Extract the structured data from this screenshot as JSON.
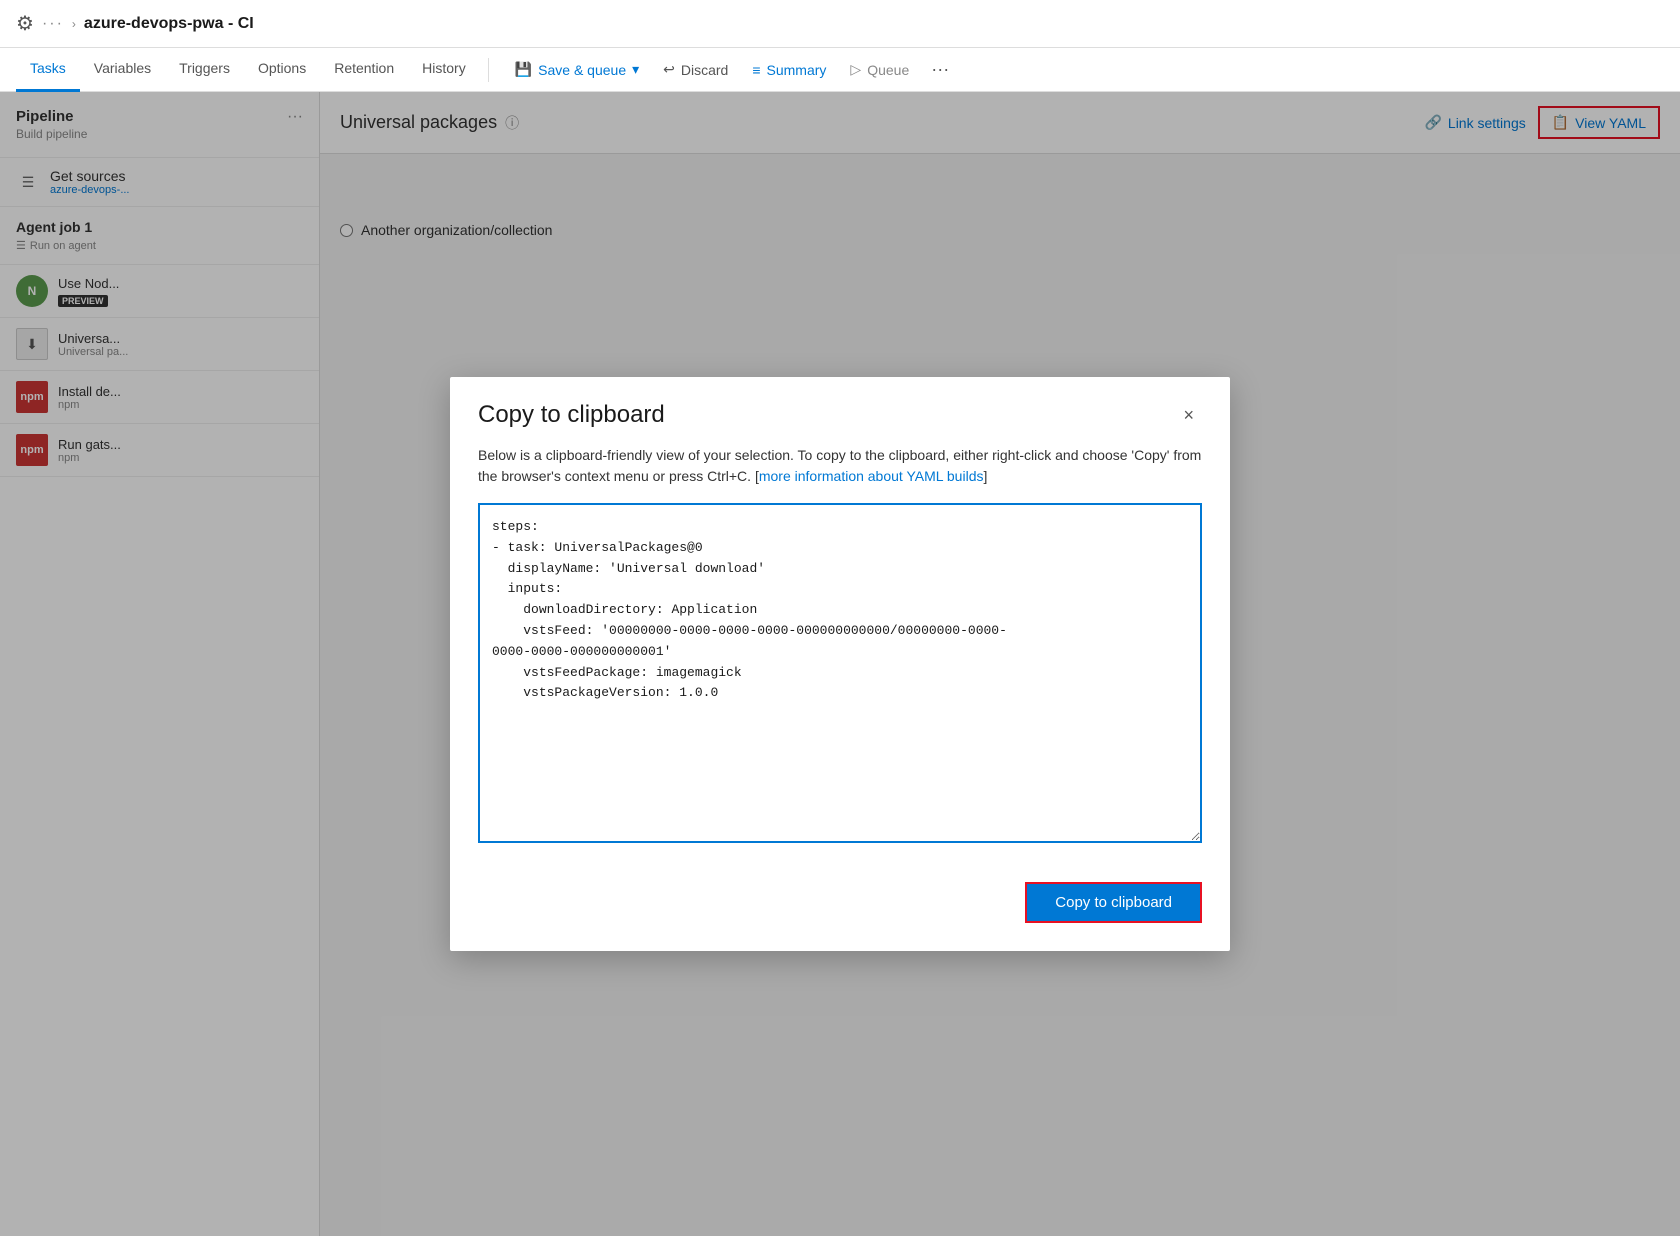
{
  "topbar": {
    "icon": "⚙",
    "dots": "···",
    "chevron": ">",
    "title": "azure-devops-pwa - CI"
  },
  "nav": {
    "tabs": [
      {
        "id": "tasks",
        "label": "Tasks",
        "active": true
      },
      {
        "id": "variables",
        "label": "Variables",
        "active": false
      },
      {
        "id": "triggers",
        "label": "Triggers",
        "active": false
      },
      {
        "id": "options",
        "label": "Options",
        "active": false
      },
      {
        "id": "retention",
        "label": "Retention",
        "active": false
      },
      {
        "id": "history",
        "label": "History",
        "active": false
      }
    ],
    "save_queue": "Save & queue",
    "discard": "Discard",
    "summary": "Summary",
    "queue": "Queue",
    "more": "···"
  },
  "left_panel": {
    "pipeline_title": "Pipeline",
    "pipeline_subtitle": "Build pipeline",
    "dots": "···",
    "get_sources_title": "Get sources",
    "get_sources_subtitle": "azure-devops-...",
    "agent_job_title": "Agent job 1",
    "agent_job_subtitle": "Run on agent",
    "tasks": [
      {
        "id": "node",
        "name": "Use Nod...",
        "desc": "",
        "badge": "PREVIEW",
        "color": "#5b9b4e"
      },
      {
        "id": "universal",
        "name": "Universa...",
        "desc": "Universal pa...",
        "badge": "",
        "color": "#cccccc"
      },
      {
        "id": "install",
        "name": "Install de...",
        "desc": "npm",
        "badge": "",
        "color": "#cc3534"
      },
      {
        "id": "run-gats",
        "name": "Run gats...",
        "desc": "npm",
        "badge": "",
        "color": "#cc3534"
      }
    ]
  },
  "right_panel": {
    "title": "Universal packages",
    "link_settings": "Link settings",
    "view_yaml": "View YAML",
    "radio_label": "Another organization/collection"
  },
  "modal": {
    "title": "Copy to clipboard",
    "close_label": "×",
    "description": "Below is a clipboard-friendly view of your selection. To copy to the clipboard, either right-click and choose 'Copy' from the browser's context menu or press Ctrl+C. [more information about YAML builds]",
    "more_link_text": "more information about YAML builds",
    "yaml_content": "steps:\n- task: UniversalPackages@0\n  displayName: 'Universal download'\n  inputs:\n    downloadDirectory: Application\n    vstsFeed: '00000000-0000-0000-0000-000000000000/00000000-0000-\n0000-0000-000000000001'\n    vstsFeedPackage: imagemagick\n    vstsPackageVersion: 1.0.0",
    "copy_button_label": "Copy to clipboard"
  }
}
